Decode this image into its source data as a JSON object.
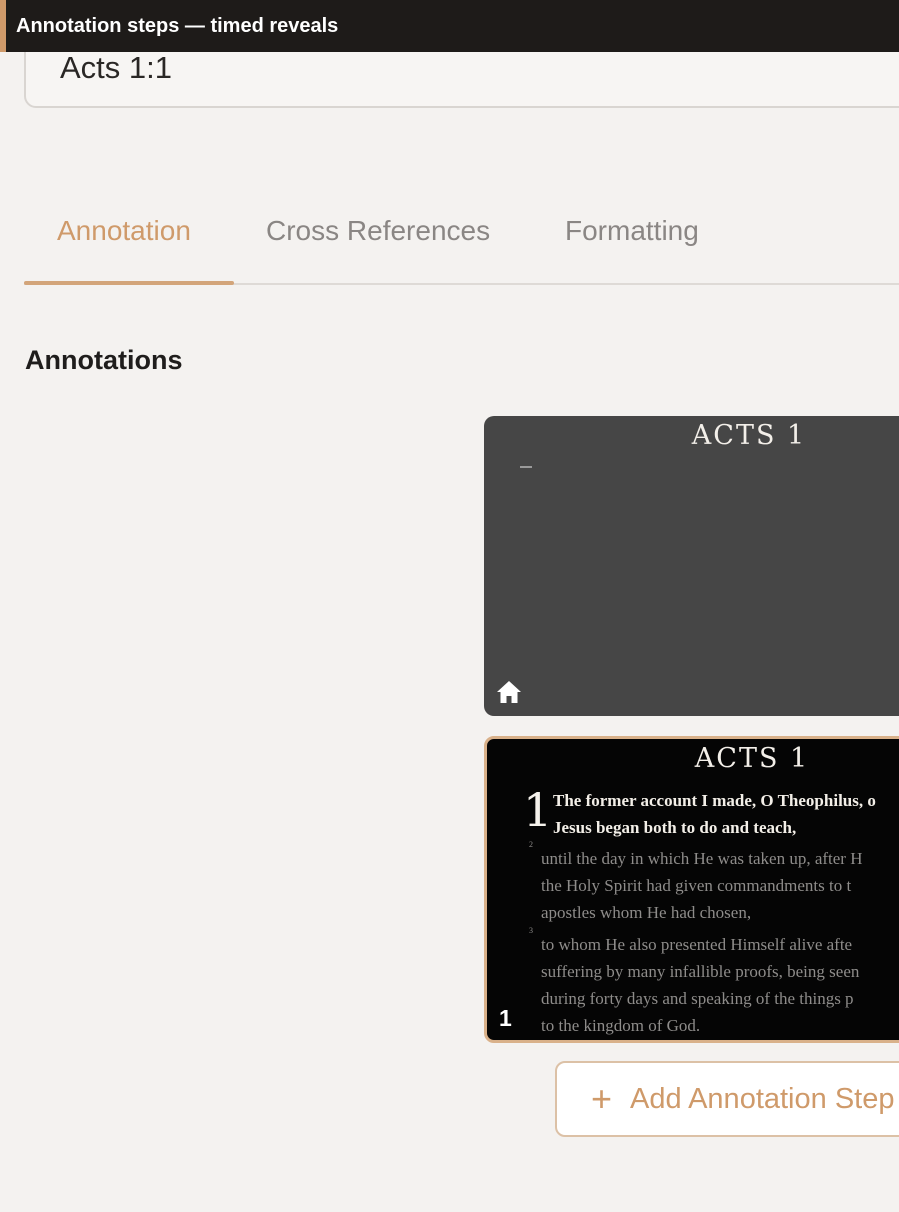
{
  "window": {
    "title": "Annotation steps — timed reveals"
  },
  "reference": {
    "value": "Acts 1:1"
  },
  "tabs": [
    {
      "label": "Annotation",
      "active": true
    },
    {
      "label": "Cross References",
      "active": false
    },
    {
      "label": "Formatting",
      "active": false
    }
  ],
  "section": {
    "title": "Annotations"
  },
  "cards": [
    {
      "title": "ACTS 1",
      "icon": "home-icon"
    },
    {
      "title": "ACTS 1",
      "step": "1",
      "verse_number": "1",
      "sup2": "2",
      "sup3": "3",
      "lines": [
        "The former account I made, O Theophilus, o",
        "Jesus began both to do and teach,",
        "until the day in which He was taken up, after H",
        "the Holy Spirit had given commandments to t",
        "apostles whom He had chosen,",
        "to whom He also presented Himself alive afte",
        "suffering by many infallible proofs, being seen",
        "during forty days and speaking of the things p",
        "to the kingdom of God."
      ]
    }
  ],
  "add_button": {
    "label": "Add Annotation Step",
    "icon": "plus-icon"
  },
  "colors": {
    "accent": "#cf9a6a",
    "titlebar": "#1e1b19",
    "background": "#f4f2f0"
  }
}
